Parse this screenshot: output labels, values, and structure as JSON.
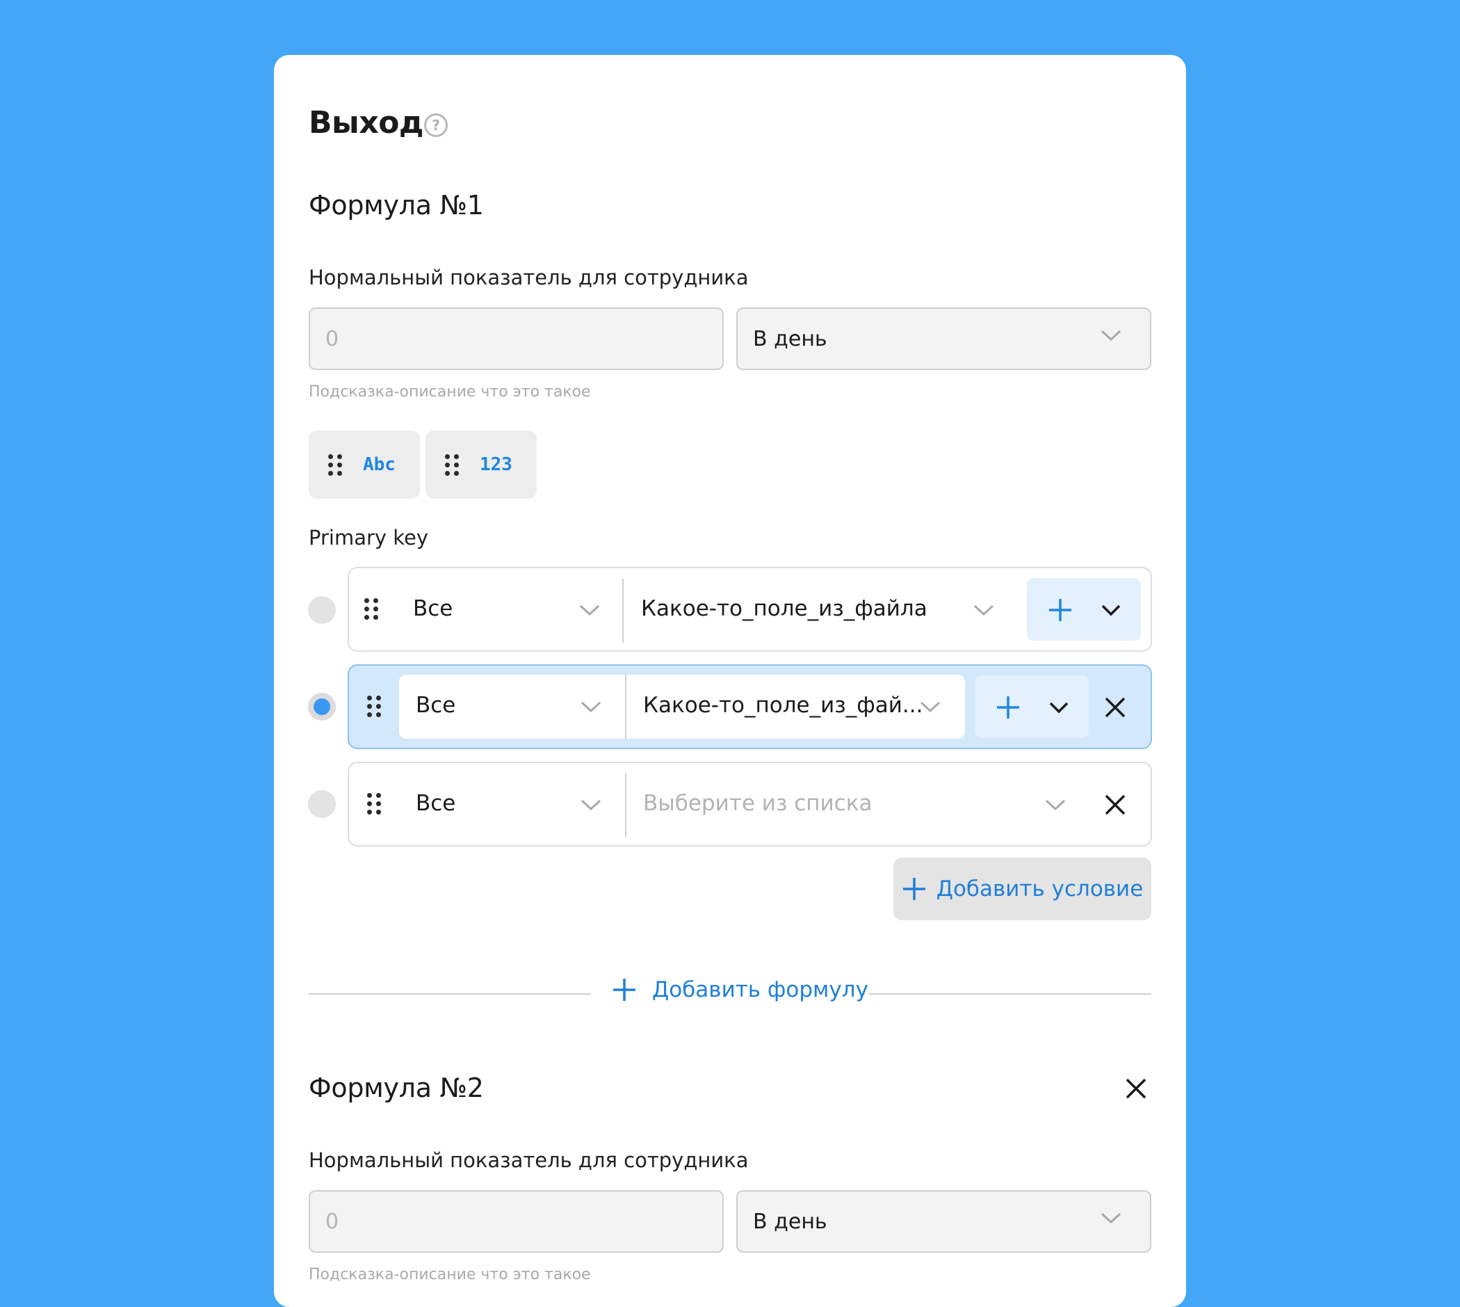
{
  "section": {
    "title": "Выход",
    "help_icon": "question-circle-icon"
  },
  "formulas": [
    {
      "title": "Формула №1",
      "norm_label": "Нормальный показатель для сотрудника",
      "norm_value_placeholder": "0",
      "period_value": "В день",
      "hint": "Подсказка-описание что это такое",
      "chips": [
        {
          "label": "Abc",
          "icon": "drag-handle-icon"
        },
        {
          "label": "123",
          "icon": "drag-handle-icon"
        }
      ],
      "primary_key_label": "Primary key",
      "rows": [
        {
          "selected": false,
          "scope": "Все",
          "field": "Какое-то_поле_из_файла",
          "field_placeholder": false,
          "removable": false
        },
        {
          "selected": true,
          "scope": "Все",
          "field": "Какое-то_поле_из_фай...",
          "field_placeholder": false,
          "removable": true
        },
        {
          "selected": false,
          "scope": "Все",
          "field": "Выберите из списка",
          "field_placeholder": true,
          "removable": true
        }
      ],
      "add_condition_label": "Добавить условие"
    },
    {
      "title": "Формула №2",
      "norm_label": "Нормальный показатель для сотрудника",
      "norm_value_placeholder": "0",
      "period_value": "В день",
      "hint": "Подсказка-описание что это такое"
    }
  ],
  "add_formula_label": "Добавить формулу",
  "colors": {
    "background": "#43A6F7",
    "accent": "#1F7FD8",
    "selected_row": "#D3E8FB",
    "radio_active": "#3B97F2"
  }
}
